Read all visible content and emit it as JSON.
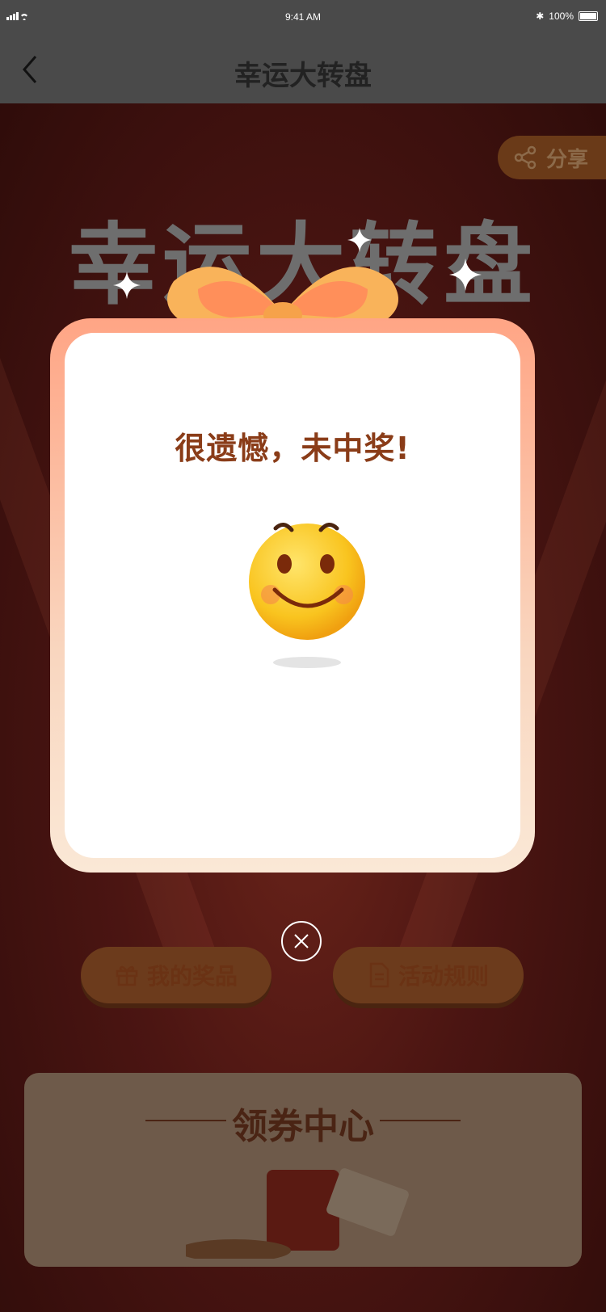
{
  "status": {
    "time": "9:41 AM",
    "battery": "100%"
  },
  "nav": {
    "title": "幸运大转盘"
  },
  "background": {
    "title": "幸运大转盘",
    "share_label": "分享"
  },
  "modal": {
    "message": "很遗憾，未中奖!"
  },
  "actions": {
    "prizes_label": "我的奖品",
    "rules_label": "活动规则"
  },
  "coupon": {
    "title": "领券中心"
  }
}
